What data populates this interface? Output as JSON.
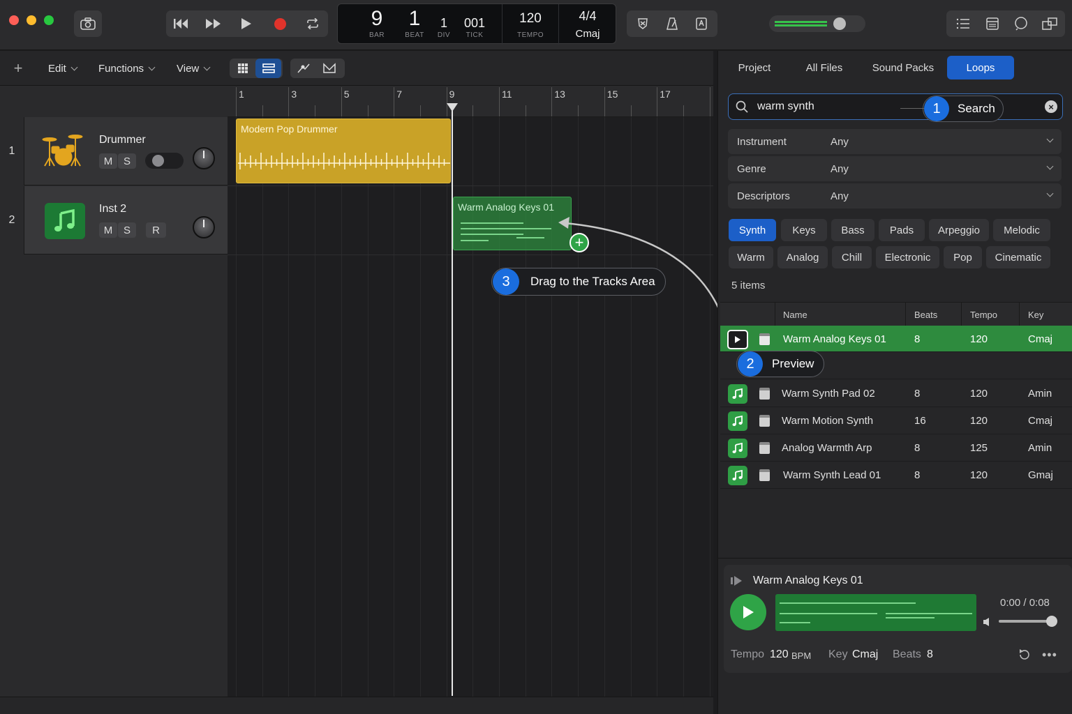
{
  "transport": {
    "bar": "9",
    "bar_caption": "BAR",
    "beat": "1",
    "beat_caption": "BEAT",
    "div": "1",
    "div_caption": "DIV",
    "tick": "001",
    "tick_caption": "TICK",
    "tempo": "120",
    "tempo_caption": "TEMPO",
    "signature": "4/4",
    "key": "Cmaj",
    "master_level": 0.75
  },
  "tracks_toolbar": {
    "edit": "Edit",
    "functions": "Functions",
    "view": "View"
  },
  "ruler": {
    "bars": [
      "1",
      "3",
      "5",
      "7",
      "9",
      "11",
      "13",
      "15",
      "17"
    ]
  },
  "tracks": [
    {
      "number": "1",
      "name": "Drummer",
      "mute": "M",
      "solo": "S",
      "icon": "drum-kit-icon"
    },
    {
      "number": "2",
      "name": "Inst 2",
      "mute": "M",
      "solo": "S",
      "record": "R",
      "icon": "music-note-icon"
    }
  ],
  "regions": {
    "drummer": "Modern Pop Drummer",
    "dragged": "Warm Analog Keys 01"
  },
  "callouts": {
    "step1_num": "1",
    "step1": "Search",
    "step2_num": "2",
    "step2": "Preview",
    "step3_num": "3",
    "step3": "Drag to the Tracks Area"
  },
  "browser": {
    "tabs": [
      "Project",
      "All Files",
      "Sound Packs",
      "Loops"
    ],
    "active_tab": "Loops",
    "search_value": "warm synth",
    "filters": [
      {
        "label": "Instrument",
        "value": "Any"
      },
      {
        "label": "Genre",
        "value": "Any"
      },
      {
        "label": "Descriptors",
        "value": "Any"
      }
    ],
    "tags_row1": [
      "Synth",
      "Keys",
      "Bass",
      "Pads",
      "Arpeggio",
      "Melodic"
    ],
    "tags_row2": [
      "Warm",
      "Analog",
      "Chill",
      "Electronic",
      "Pop",
      "Cinematic"
    ],
    "active_tag": "Synth",
    "count": "5 items",
    "columns": {
      "name": "Name",
      "beats": "Beats",
      "tempo": "Tempo",
      "key": "Key"
    },
    "rows": [
      {
        "name": "Warm Analog Keys 01",
        "beats": "8",
        "tempo": "120",
        "key": "Cmaj",
        "selected": true
      },
      {
        "name": "Warm Synth Pad 02",
        "beats": "8",
        "tempo": "120",
        "key": "Amin"
      },
      {
        "name": "Warm Motion Synth",
        "beats": "16",
        "tempo": "120",
        "key": "Cmaj"
      },
      {
        "name": "Analog Warmth Arp",
        "beats": "8",
        "tempo": "125",
        "key": "Amin"
      },
      {
        "name": "Warm Synth Lead 01",
        "beats": "8",
        "tempo": "120",
        "key": "Gmaj"
      }
    ]
  },
  "preview": {
    "title": "Warm Analog Keys 01",
    "time": "0:00 / 0:08",
    "tempo_label": "Tempo",
    "tempo_value": "120",
    "tempo_unit": "BPM",
    "key_label": "Key",
    "key_value": "Cmaj",
    "beats_label": "Beats",
    "beats_value": "8",
    "volume": 0.95
  },
  "colors": {
    "accent": "#1c5fc8",
    "loop_green": "#2e8b3e",
    "drummer_gold": "#c9a227",
    "record_red": "#e0332b"
  }
}
